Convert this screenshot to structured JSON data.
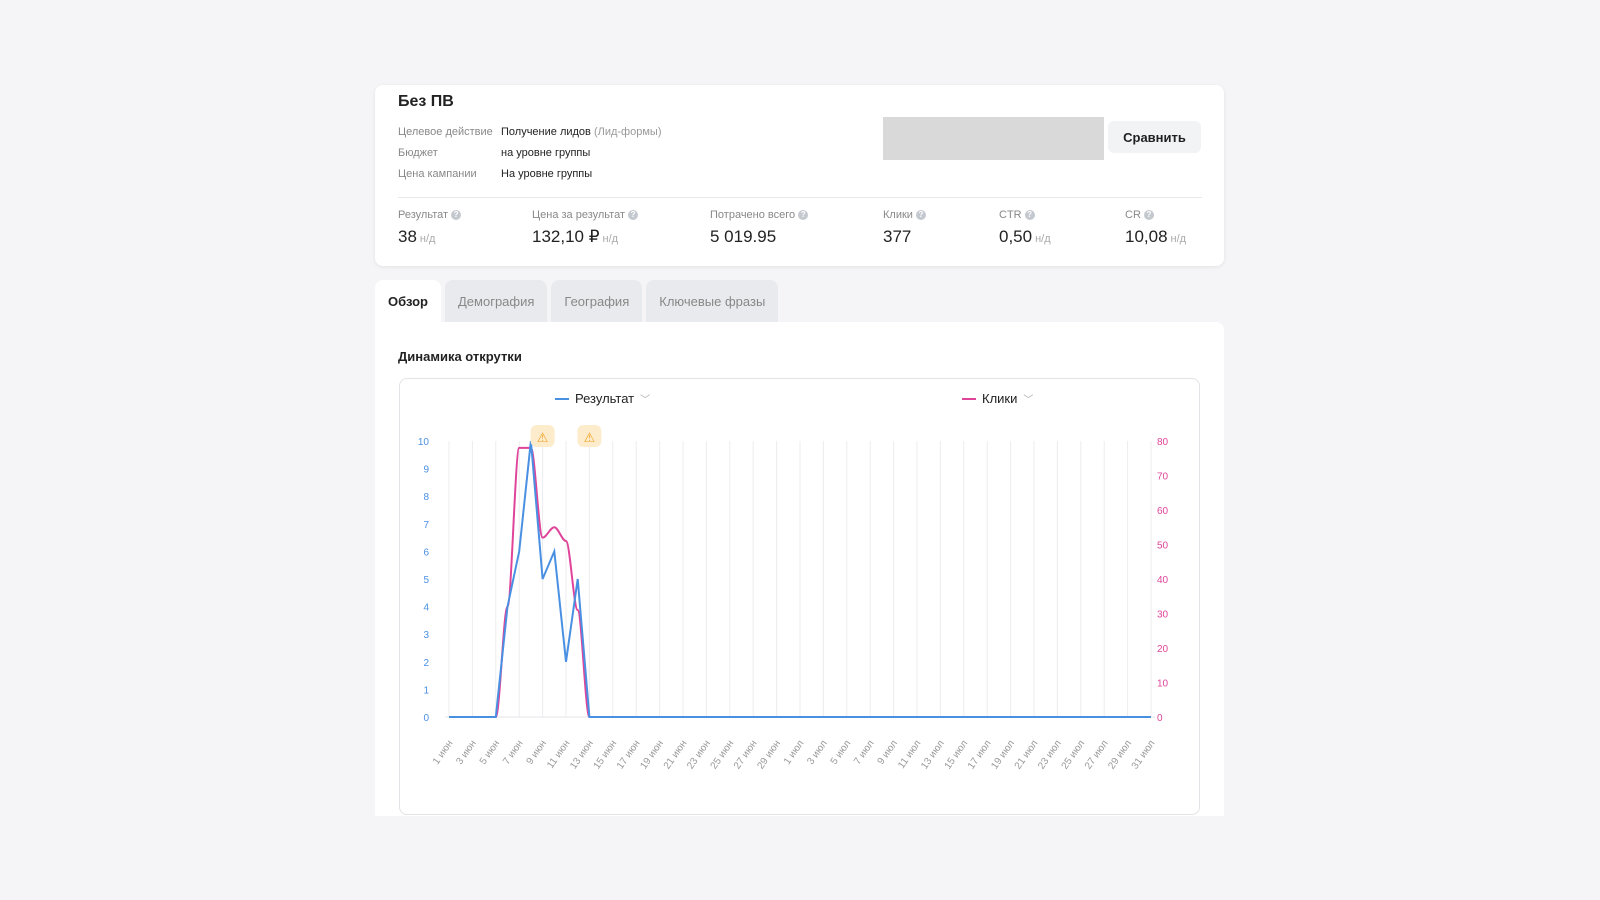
{
  "campaign": {
    "title": "Без ПВ",
    "params": [
      {
        "key": "Целевое действие",
        "value": "Получение лидов",
        "muted": "(Лид-формы)"
      },
      {
        "key": "Бюджет",
        "value": "на уровне группы",
        "muted": ""
      },
      {
        "key": "Цена кампании",
        "value": "На уровне группы",
        "muted": ""
      }
    ],
    "compare_label": "Сравнить"
  },
  "stats": [
    {
      "label": "Результат",
      "value": "38",
      "suffix": "н/д"
    },
    {
      "label": "Цена за результат",
      "value": "132,10 ₽",
      "suffix": "н/д"
    },
    {
      "label": "Потрачено всего",
      "value": "5 019.95",
      "suffix": ""
    },
    {
      "label": "Клики",
      "value": "377",
      "suffix": ""
    },
    {
      "label": "CTR",
      "value": "0,50",
      "suffix": "н/д"
    },
    {
      "label": "CR",
      "value": "10,08",
      "suffix": "н/д"
    }
  ],
  "help_glyph": "?",
  "tabs": [
    "Обзор",
    "Демография",
    "География",
    "Ключевые фразы"
  ],
  "section_title": "Динамика открутки",
  "chart_data": {
    "type": "line",
    "x": [
      "1 июн",
      "2 июн",
      "3 июн",
      "4 июн",
      "5 июн",
      "6 июн",
      "7 июн",
      "8 июн",
      "9 июн",
      "10 июн",
      "11 июн",
      "12 июн",
      "13 июн",
      "14 июн",
      "15 июн",
      "16 июн",
      "17 июн",
      "18 июн",
      "19 июн",
      "20 июн",
      "21 июн",
      "22 июн",
      "23 июн",
      "24 июн",
      "25 июн",
      "26 июн",
      "27 июн",
      "28 июн",
      "29 июн",
      "30 июн",
      "1 июл",
      "2 июл",
      "3 июл",
      "4 июл",
      "5 июл",
      "6 июл",
      "7 июл",
      "8 июл",
      "9 июл",
      "10 июл",
      "11 июл",
      "12 июл",
      "13 июл",
      "14 июл",
      "15 июл",
      "16 июл",
      "17 июл",
      "18 июл",
      "19 июл",
      "20 июл",
      "21 июл",
      "22 июл",
      "23 июл",
      "24 июл",
      "25 июл",
      "26 июл",
      "27 июл",
      "28 июл",
      "29 июл",
      "30 июл",
      "31 июл"
    ],
    "tick_every": 2,
    "series": [
      {
        "name": "Результат",
        "axis": "left",
        "color": "#4a90e2",
        "values": [
          0,
          0,
          0,
          0,
          0,
          4,
          6,
          10,
          5,
          6,
          2,
          5,
          0,
          0,
          0,
          0,
          0,
          0,
          0,
          0,
          0,
          0,
          0,
          0,
          0,
          0,
          0,
          0,
          0,
          0,
          0,
          0,
          0,
          0,
          0,
          0,
          0,
          0,
          0,
          0,
          0,
          0,
          0,
          0,
          0,
          0,
          0,
          0,
          0,
          0,
          0,
          0,
          0,
          0,
          0,
          0,
          0,
          0,
          0,
          0,
          0
        ]
      },
      {
        "name": "Клики",
        "axis": "right",
        "color": "#e0449a",
        "values": [
          0,
          0,
          0,
          0,
          0,
          32,
          78,
          78,
          52,
          55,
          51,
          31,
          0,
          0,
          0,
          0,
          0,
          0,
          0,
          0,
          0,
          0,
          0,
          0,
          0,
          0,
          0,
          0,
          0,
          0,
          0,
          0,
          0,
          0,
          0,
          0,
          0,
          0,
          0,
          0,
          0,
          0,
          0,
          0,
          0,
          0,
          0,
          0,
          0,
          0,
          0,
          0,
          0,
          0,
          0,
          0,
          0,
          0,
          0,
          0,
          0
        ]
      }
    ],
    "left_axis": {
      "range": [
        0,
        10
      ],
      "ticks": [
        "0",
        "1",
        "2",
        "3",
        "4",
        "5",
        "6",
        "7",
        "8",
        "9",
        "10"
      ]
    },
    "right_axis": {
      "range": [
        0,
        80
      ],
      "ticks": [
        "0",
        "10",
        "20",
        "30",
        "40",
        "50",
        "60",
        "70",
        "80"
      ]
    },
    "warnings_at": [
      "9 июн",
      "13 июн"
    ],
    "warning_glyph": "⚠",
    "legend_chevron": "﹀",
    "grid": true
  }
}
